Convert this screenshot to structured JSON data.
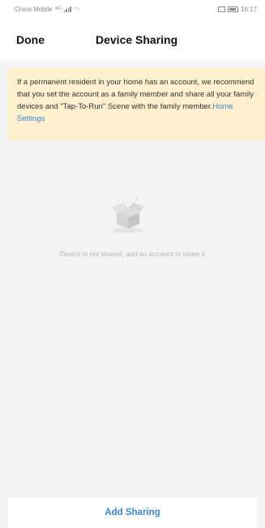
{
  "status_bar": {
    "carrier": "China Mobile",
    "signal_label": "4G",
    "time": "16:17"
  },
  "nav": {
    "done_label": "Done",
    "title": "Device Sharing"
  },
  "notice": {
    "text": "If a permanent resident in your home has an account, we recommend that you set the account as a family member and share all your family devices and \"Tap-To-Run\" Scene with the family member.",
    "link_label": "Home Settings"
  },
  "empty_state": {
    "message": "Device is not shared, add an account to share it",
    "icon": "empty-box-icon"
  },
  "footer": {
    "add_sharing_label": "Add Sharing"
  },
  "colors": {
    "accent": "#3c86d6",
    "notice_background": "#fdf0cf",
    "page_background": "#f3f3f5"
  }
}
